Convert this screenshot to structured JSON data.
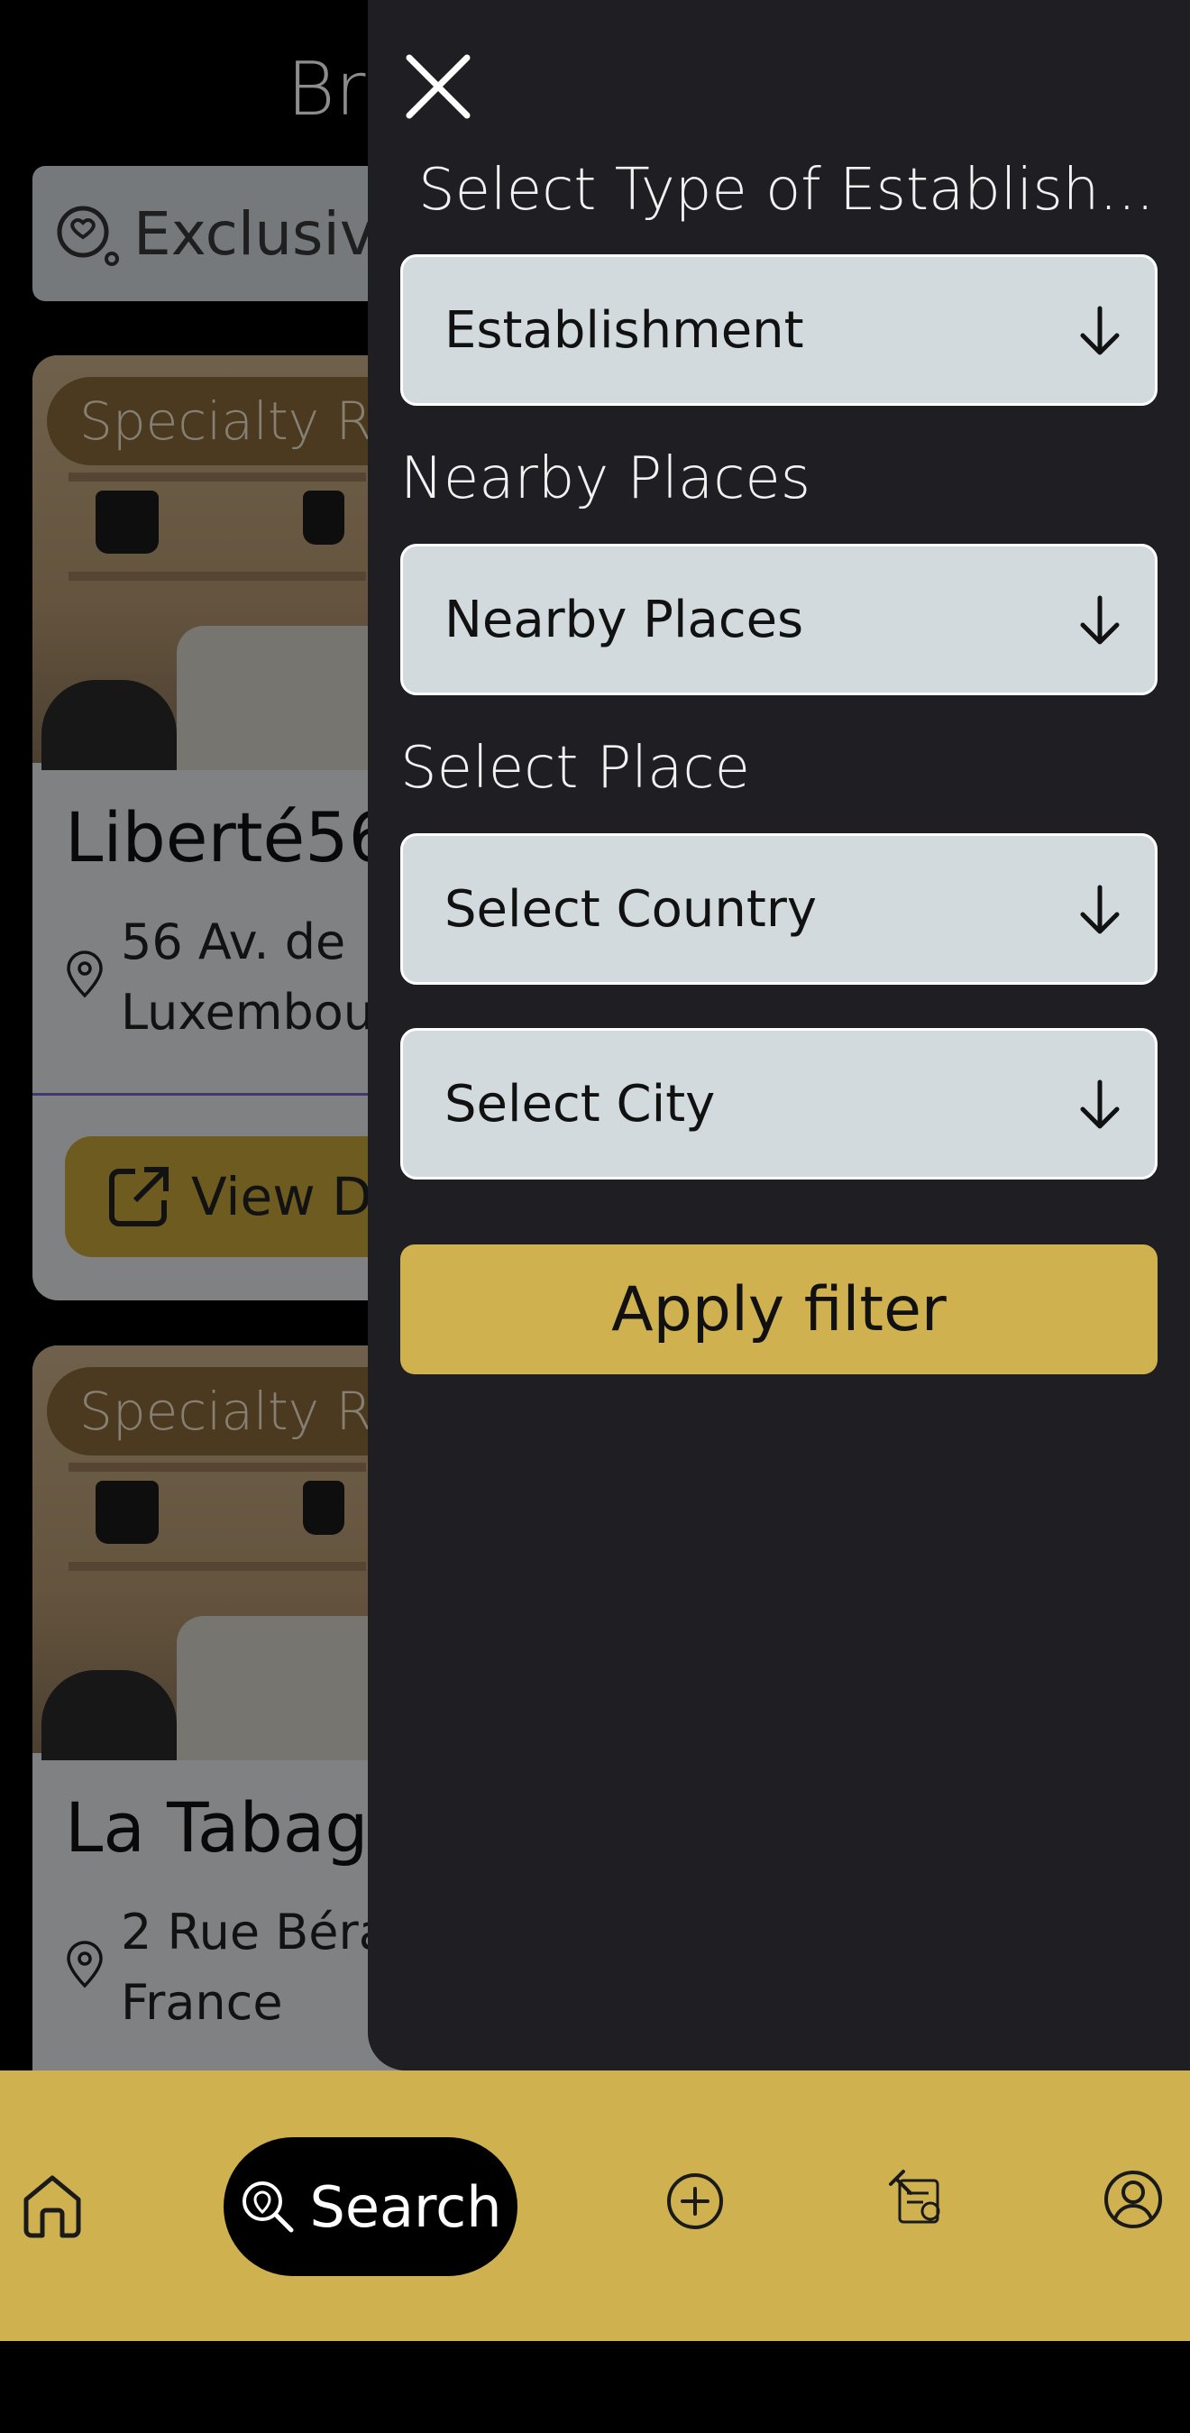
{
  "background": {
    "page_title": "Br",
    "chip_label": "Exclusiv",
    "cards": [
      {
        "tag": "Specialty Re",
        "name": "Liberté56",
        "address": "56 Av. de\nLuxembou",
        "button_label": "View D"
      },
      {
        "tag": "Specialty Re",
        "name": "La Tabag",
        "address": "2 Rue Béra\nFrance"
      }
    ]
  },
  "filter_drawer": {
    "establishment_title": "Select Type of Establish...",
    "establishment_value": "Establishment",
    "nearby_title": "Nearby Places",
    "nearby_value": "Nearby Places",
    "place_title": "Select Place",
    "country_value": "Select Country",
    "city_value": "Select City",
    "apply_label": "Apply filter"
  },
  "bottom_nav": {
    "items": [
      {
        "icon": "home-icon"
      },
      {
        "icon": "search-location-icon",
        "label": "Search"
      },
      {
        "icon": "add-circle-icon"
      },
      {
        "icon": "auction-icon"
      },
      {
        "icon": "profile-icon"
      }
    ]
  },
  "colors": {
    "drawer_bg": "#1f1e23",
    "accent": "#cfb150",
    "dropdown_bg": "#d2dadd"
  }
}
